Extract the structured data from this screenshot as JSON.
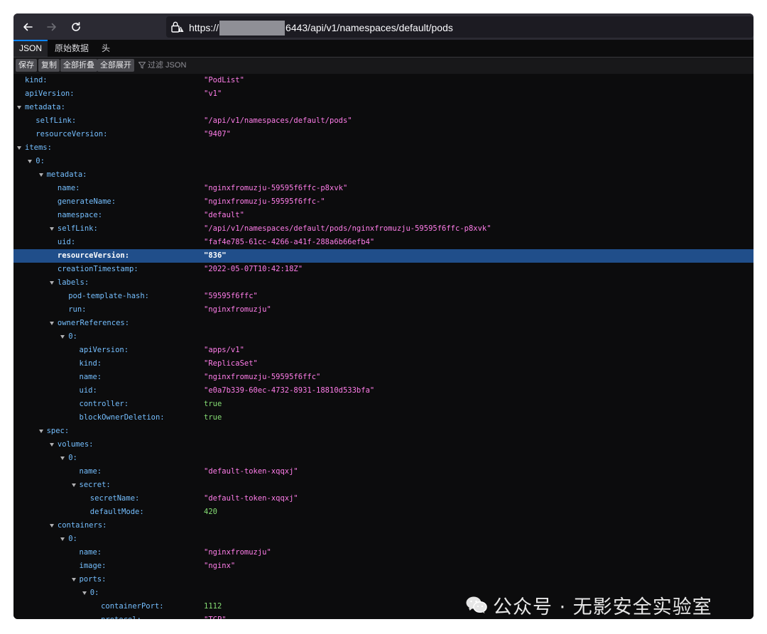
{
  "browser": {
    "url_prefix": "https://",
    "url_suffix": "6443/api/v1/namespaces/default/pods"
  },
  "tabs": [
    "JSON",
    "原始数据",
    "头"
  ],
  "actions": [
    "保存",
    "复制",
    "全部折叠",
    "全部展开"
  ],
  "filter_label": "过滤 JSON",
  "rows": [
    {
      "key": "kind:",
      "value": "\"PodList\"",
      "type": "str",
      "indent": 0,
      "twisty": false
    },
    {
      "key": "apiVersion:",
      "value": "\"v1\"",
      "type": "str",
      "indent": 0,
      "twisty": false
    },
    {
      "key": "metadata:",
      "value": "",
      "type": "",
      "indent": 0,
      "twisty": true
    },
    {
      "key": "selfLink:",
      "value": "\"/api/v1/namespaces/default/pods\"",
      "type": "str",
      "indent": 1,
      "twisty": false
    },
    {
      "key": "resourceVersion:",
      "value": "\"9407\"",
      "type": "str",
      "indent": 1,
      "twisty": false
    },
    {
      "key": "items:",
      "value": "",
      "type": "",
      "indent": 0,
      "twisty": true
    },
    {
      "key": "0:",
      "value": "",
      "type": "",
      "indent": 1,
      "twisty": true
    },
    {
      "key": "metadata:",
      "value": "",
      "type": "",
      "indent": 2,
      "twisty": true
    },
    {
      "key": "name:",
      "value": "\"nginxfromuzju-59595f6ffc-p8xvk\"",
      "type": "str",
      "indent": 3,
      "twisty": false
    },
    {
      "key": "generateName:",
      "value": "\"nginxfromuzju-59595f6ffc-\"",
      "type": "str",
      "indent": 3,
      "twisty": false
    },
    {
      "key": "namespace:",
      "value": "\"default\"",
      "type": "str",
      "indent": 3,
      "twisty": false
    },
    {
      "key": "selfLink:",
      "value": "\"/api/v1/namespaces/default/pods/nginxfromuzju-59595f6ffc-p8xvk\"",
      "type": "str",
      "indent": 3,
      "twisty": true
    },
    {
      "key": "uid:",
      "value": "\"faf4e785-61cc-4266-a41f-288a6b66efb4\"",
      "type": "str",
      "indent": 3,
      "twisty": false
    },
    {
      "key": "resourceVersion:",
      "value": "\"836\"",
      "type": "str",
      "indent": 3,
      "twisty": false,
      "selected": true
    },
    {
      "key": "creationTimestamp:",
      "value": "\"2022-05-07T10:42:18Z\"",
      "type": "str",
      "indent": 3,
      "twisty": false
    },
    {
      "key": "labels:",
      "value": "",
      "type": "",
      "indent": 3,
      "twisty": true
    },
    {
      "key": "pod-template-hash:",
      "value": "\"59595f6ffc\"",
      "type": "str",
      "indent": 4,
      "twisty": false
    },
    {
      "key": "run:",
      "value": "\"nginxfromuzju\"",
      "type": "str",
      "indent": 4,
      "twisty": false
    },
    {
      "key": "ownerReferences:",
      "value": "",
      "type": "",
      "indent": 3,
      "twisty": true
    },
    {
      "key": "0:",
      "value": "",
      "type": "",
      "indent": 4,
      "twisty": true
    },
    {
      "key": "apiVersion:",
      "value": "\"apps/v1\"",
      "type": "str",
      "indent": 5,
      "twisty": false
    },
    {
      "key": "kind:",
      "value": "\"ReplicaSet\"",
      "type": "str",
      "indent": 5,
      "twisty": false
    },
    {
      "key": "name:",
      "value": "\"nginxfromuzju-59595f6ffc\"",
      "type": "str",
      "indent": 5,
      "twisty": false
    },
    {
      "key": "uid:",
      "value": "\"e0a7b339-60ec-4732-8931-18810d533bfa\"",
      "type": "str",
      "indent": 5,
      "twisty": false
    },
    {
      "key": "controller:",
      "value": "true",
      "type": "bool",
      "indent": 5,
      "twisty": false
    },
    {
      "key": "blockOwnerDeletion:",
      "value": "true",
      "type": "bool",
      "indent": 5,
      "twisty": false
    },
    {
      "key": "spec:",
      "value": "",
      "type": "",
      "indent": 2,
      "twisty": true
    },
    {
      "key": "volumes:",
      "value": "",
      "type": "",
      "indent": 3,
      "twisty": true
    },
    {
      "key": "0:",
      "value": "",
      "type": "",
      "indent": 4,
      "twisty": true
    },
    {
      "key": "name:",
      "value": "\"default-token-xqqxj\"",
      "type": "str",
      "indent": 5,
      "twisty": false
    },
    {
      "key": "secret:",
      "value": "",
      "type": "",
      "indent": 5,
      "twisty": true
    },
    {
      "key": "secretName:",
      "value": "\"default-token-xqqxj\"",
      "type": "str",
      "indent": 6,
      "twisty": false
    },
    {
      "key": "defaultMode:",
      "value": "420",
      "type": "num",
      "indent": 6,
      "twisty": false
    },
    {
      "key": "containers:",
      "value": "",
      "type": "",
      "indent": 3,
      "twisty": true
    },
    {
      "key": "0:",
      "value": "",
      "type": "",
      "indent": 4,
      "twisty": true
    },
    {
      "key": "name:",
      "value": "\"nginxfromuzju\"",
      "type": "str",
      "indent": 5,
      "twisty": false
    },
    {
      "key": "image:",
      "value": "\"nginx\"",
      "type": "str",
      "indent": 5,
      "twisty": false
    },
    {
      "key": "ports:",
      "value": "",
      "type": "",
      "indent": 5,
      "twisty": true
    },
    {
      "key": "0:",
      "value": "",
      "type": "",
      "indent": 6,
      "twisty": true
    },
    {
      "key": "containerPort:",
      "value": "1112",
      "type": "num",
      "indent": 7,
      "twisty": false
    },
    {
      "key": "protocol:",
      "value": "\"TCP\"",
      "type": "str",
      "indent": 7,
      "twisty": false
    }
  ],
  "watermark": "公众号 · 无影安全实验室",
  "icons": [
    "back-arrow-icon",
    "forward-arrow-icon",
    "reload-icon",
    "lock-icon",
    "filter-icon",
    "wechat-icon"
  ]
}
